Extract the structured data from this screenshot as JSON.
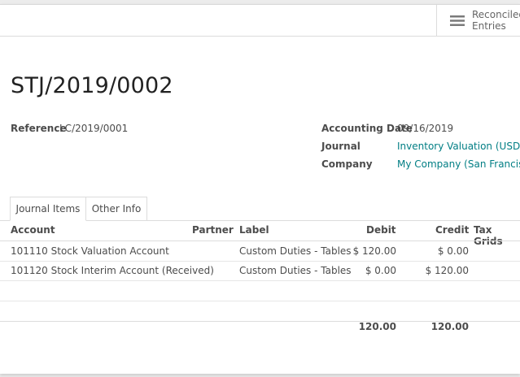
{
  "smart_button": {
    "label_line1": "Reconciled",
    "label_line2": "Entries",
    "icon": "list-icon"
  },
  "title": "STJ/2019/0002",
  "fields": {
    "reference_label": "Reference",
    "reference_value": "LC/2019/0001",
    "date_label": "Accounting Date",
    "date_value": "09/16/2019",
    "journal_label": "Journal",
    "journal_value": "Inventory Valuation (USD)",
    "company_label": "Company",
    "company_value": "My Company (San Francisco)"
  },
  "tabs": [
    {
      "label": "Journal Items",
      "active": true
    },
    {
      "label": "Other Info",
      "active": false
    }
  ],
  "columns": {
    "account": "Account",
    "partner": "Partner",
    "label": "Label",
    "debit": "Debit",
    "credit": "Credit",
    "tax_grids": "Tax Grids"
  },
  "rows": [
    {
      "account": "101110 Stock Valuation Account",
      "partner": "",
      "label": "Custom Duties - Tables",
      "debit": "$ 120.00",
      "credit": "$ 0.00"
    },
    {
      "account": "101120 Stock Interim Account (Received)",
      "partner": "",
      "label": "Custom Duties - Tables",
      "debit": "$ 0.00",
      "credit": "$ 120.00"
    }
  ],
  "totals": {
    "debit": "120.00",
    "credit": "120.00"
  },
  "colors": {
    "link": "#017e84",
    "text": "#4c4c4c",
    "border": "#dcdcdc"
  }
}
